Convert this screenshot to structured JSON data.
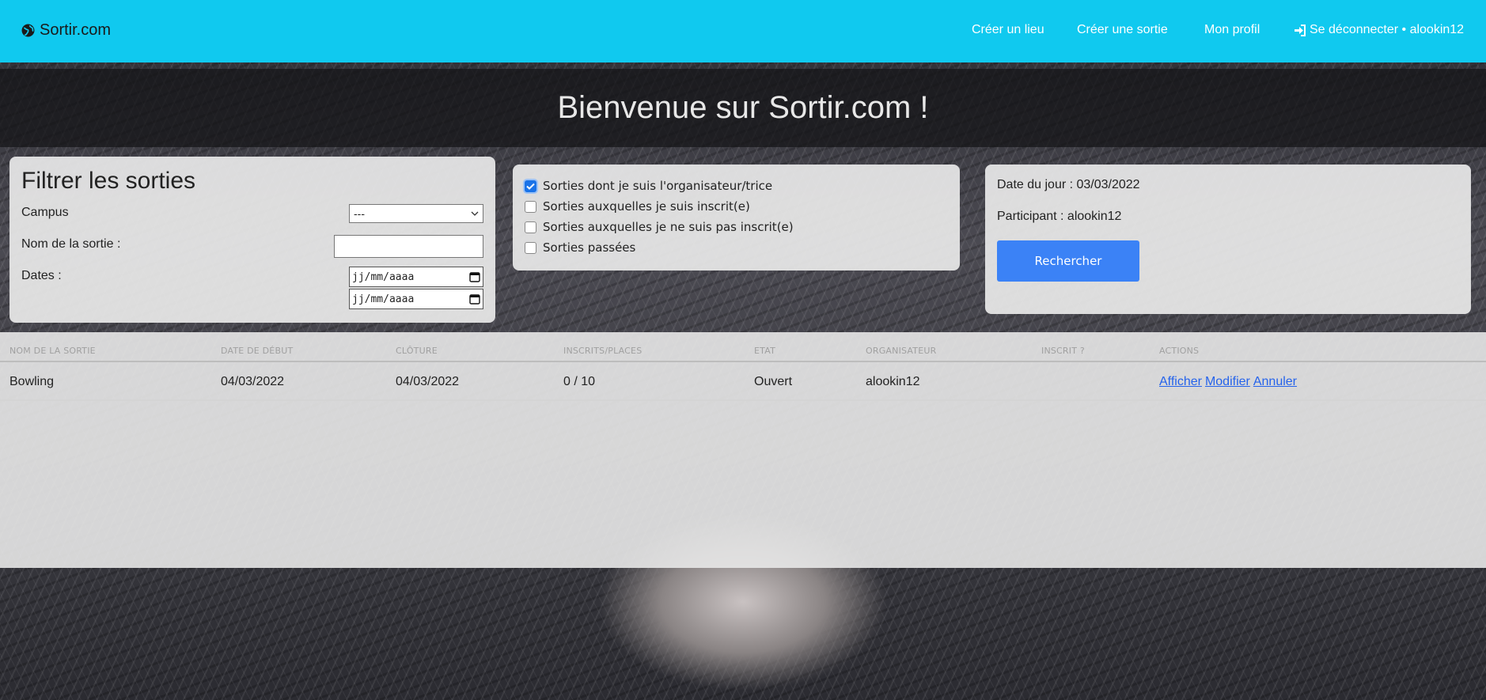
{
  "nav": {
    "brand": "Sortir.com",
    "brand_icon": "globe-icon",
    "links": [
      "Créer un lieu",
      "Créer une sortie",
      "Mon profil"
    ],
    "logout": "Se déconnecter • alookin12",
    "logout_icon": "sign-in-icon"
  },
  "banner": {
    "title": "Bienvenue sur Sortir.com !"
  },
  "filter": {
    "title": "Filtrer les sorties",
    "campus_label": "Campus",
    "campus_value": "---",
    "name_label": "Nom de la sortie :",
    "name_value": "",
    "dates_label": "Dates :",
    "date_from": "jj/mm/aaaa",
    "date_to": "jj/mm/aaaa"
  },
  "checks": [
    {
      "label": "Sorties dont je suis l'organisateur/trice",
      "checked": true
    },
    {
      "label": "Sorties auxquelles je suis inscrit(e)",
      "checked": false
    },
    {
      "label": "Sorties auxquelles je ne suis pas inscrit(e)",
      "checked": false
    },
    {
      "label": "Sorties passées",
      "checked": false
    }
  ],
  "info": {
    "date_line": "Date du jour : 03/03/2022",
    "participant_line": "Participant : alookin12",
    "search_button": "Rechercher"
  },
  "table": {
    "headers": [
      "Nom de la sortie",
      "Date de début",
      "Clôture",
      "Inscrits/places",
      "Etat",
      "Organisateur",
      "Inscrit ?",
      "Actions"
    ],
    "rows": [
      {
        "name": "Bowling",
        "start": "04/03/2022",
        "close": "04/03/2022",
        "places": "0 / 10",
        "state": "Ouvert",
        "organizer": "alookin12",
        "registered": "",
        "actions": [
          "Afficher",
          "Modifier",
          "Annuler"
        ]
      }
    ]
  },
  "colors": {
    "navbar": "#10c9ef",
    "button": "#3b82f6",
    "link": "#2563eb"
  }
}
